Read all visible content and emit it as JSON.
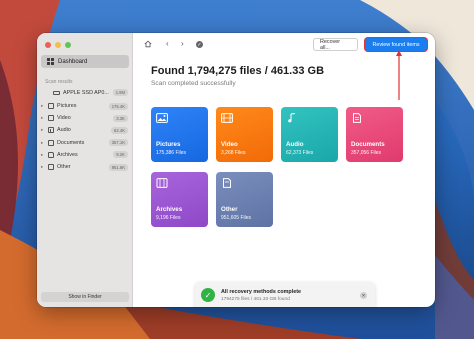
{
  "colors": {
    "accent": "#1a7ef0",
    "annotation": "#e0342f",
    "success": "#2fb344"
  },
  "sidebar": {
    "dashboard_label": "Dashboard",
    "scan_results_heading": "Scan results",
    "drive": {
      "label": "APPLE SSD AP0...",
      "badge": "1.9M"
    },
    "items": [
      {
        "label": "Pictures",
        "badge": "175.4K",
        "icon": "image-icon"
      },
      {
        "label": "Video",
        "badge": "3.3K",
        "icon": "video-icon"
      },
      {
        "label": "Audio",
        "badge": "62.4K",
        "icon": "music-icon"
      },
      {
        "label": "Documents",
        "badge": "357.1K",
        "icon": "document-icon"
      },
      {
        "label": "Archives",
        "badge": "9.2K",
        "icon": "archive-icon"
      },
      {
        "label": "Other",
        "badge": "951.6K",
        "icon": "file-icon"
      }
    ],
    "show_in_finder": "Show in Finder"
  },
  "toolbar": {
    "recover_all": "Recover all...",
    "review_found": "Review found items"
  },
  "main": {
    "title": "Found 1,794,275 files / 461.33 GB",
    "subtitle": "Scan completed successfully",
    "cards": [
      {
        "label": "Pictures",
        "count": "175,386 Files"
      },
      {
        "label": "Video",
        "count": "3,268 Files"
      },
      {
        "label": "Audio",
        "count": "62,373 Files"
      },
      {
        "label": "Documents",
        "count": "357,056 Files"
      },
      {
        "label": "Archives",
        "count": "9,196 Files"
      },
      {
        "label": "Other",
        "count": "951,605 Files"
      }
    ]
  },
  "toast": {
    "title": "All recovery methods complete",
    "subtitle": "1794275 files / 461.33 GB found"
  }
}
